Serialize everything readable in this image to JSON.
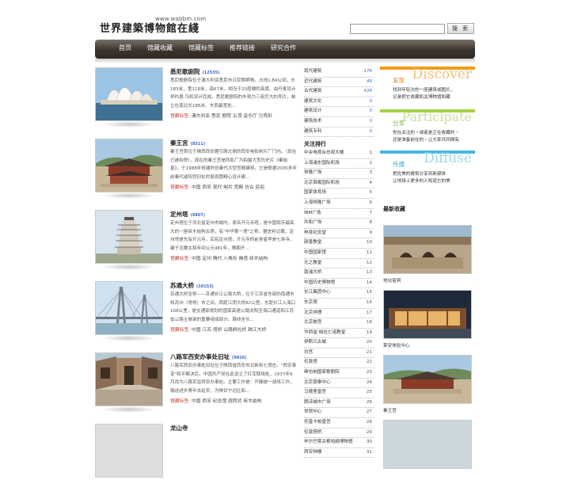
{
  "header": {
    "logo_url": "www.wabbm.com",
    "logo_text": "世界建築博物館在綫",
    "search_placeholder": "",
    "search_button": "搜 索"
  },
  "nav": [
    "首页",
    "馆藏收藏",
    "馆藏标签",
    "推荐链接",
    "研究合作"
  ],
  "entries": [
    {
      "title": "悉尼歌剧院",
      "count": "(12535)",
      "desc": "悉尼歌剧院位于澳大利亚悉尼市贝尼朗岬角。占地1.84公顷，长183米，宽118米，高67米，相当于20层楼的高度。由丹麦设计师约恩·乌松设计完成。悉尼歌剧院的外观为三组巨大的壳片，耸立在南北长186米、东西最宽处...",
      "tags_label": "馆藏标签:",
      "tags": "澳大利亚 悉尼 剧院 尖顶 音乐厅 贝壳形"
    },
    {
      "title": "秦王宫",
      "count": "(8511)",
      "desc": "秦王宫首位于陕西西安雁引路北侧的西安电影制片厂门内。（现在已被拆除），现在的秦王宫是西影厂为拍摄大型历史片《秦始皇》，于1988年修建的仿秦代大型宫殿建筑。它是根据2000多年前秦代咸阳宫旧址的复原图精心设计建...",
      "tags_label": "馆藏标签:",
      "tags": "中国 西安 现代 制片 宫殿 仿古 民俗"
    },
    {
      "title": "定州塔",
      "count": "(9807)",
      "desc": "定州塔位于河北省定州市城内，原名开元寺塔，是中国现存最高大的一座砖木结构古塔，有\"中华第一塔\"之称。据史料记载，定州塔是先有开元寺，后有定州塔。开元寺的前身星早是七帝寺，建于北魏太和年间公元481年，隋朝开...",
      "tags_label": "馆藏标签:",
      "tags": "中国 定州 隋代 八角形 佛塔 砖木结构"
    },
    {
      "title": "苏通大桥",
      "count": "(10153)",
      "desc": "苏通大桥全称——苏通长江公路大桥，位于江苏省东部的南通市和苏州（常熟）市之间，西距江阴大桥82公里，东距长江入海口108公里，是交通部规划的国家高速公路沈阳至海口通道和江苏省公路主骨架的重要组成部分。路线全长...",
      "tags_label": "馆藏标签:",
      "tags": "中国 江苏 塔桥 公路斜拉桥 跨江大桥"
    },
    {
      "title": "八路军西安办事处旧址",
      "count": "(9826)",
      "desc": "八路军西安办事处旧址位于陕西省西安市北新街七贤庄。\"西安事变\"和平解决后，中国共产党在此设立了红军联络处，1937年9月改为八路军驻西安办事处。主要工作是：开展统一战线工作，输送进步青年去延安，为陕甘宁边区和...",
      "tags_label": "馆藏标签:",
      "tags": "中国 西安 纪念馆 庭院式 砖木结构"
    },
    {
      "title": "龙山寺",
      "count": "",
      "desc": "",
      "tags_label": "",
      "tags": ""
    }
  ],
  "categories": [
    {
      "label": "现代建筑",
      "count": "176"
    },
    {
      "label": "近代建筑",
      "count": "49"
    },
    {
      "label": "古代建筑",
      "count": "439"
    },
    {
      "label": "建筑文化",
      "count": "0"
    },
    {
      "label": "建筑设计",
      "count": "0"
    },
    {
      "label": "建筑技术",
      "count": "0"
    },
    {
      "label": "建筑专利",
      "count": "0"
    }
  ],
  "hot": {
    "title": "关注排行",
    "items": [
      {
        "label": "中央电视台总部大楼",
        "rank": "1"
      },
      {
        "label": "上海浦东国际机场",
        "rank": "2"
      },
      {
        "label": "恒隆广场",
        "rank": "3"
      },
      {
        "label": "北京首都国际机场",
        "rank": "4"
      },
      {
        "label": "国家体育场",
        "rank": "5"
      },
      {
        "label": "上海恒隆广场",
        "rank": "6"
      },
      {
        "label": "IBM广场",
        "rank": "7"
      },
      {
        "label": "共和广场",
        "rank": "8"
      },
      {
        "label": "林肯纪念堂",
        "rank": "9"
      },
      {
        "label": "颜香教堂",
        "rank": "10"
      },
      {
        "label": "中国国家馆",
        "rank": "11"
      },
      {
        "label": "光之教堂",
        "rank": "12"
      },
      {
        "label": "南浦大桥",
        "rank": "13"
      },
      {
        "label": "中国历史博物馆",
        "rank": "14"
      },
      {
        "label": "长江集团中心",
        "rank": "15"
      },
      {
        "label": "东京塔",
        "rank": "16"
      },
      {
        "label": "北京祥理",
        "rank": "17"
      },
      {
        "label": "北京故宫",
        "rank": "18"
      },
      {
        "label": "华西堂-柏拉仁诺教堂",
        "rank": "19"
      },
      {
        "label": "伊斯兰古城",
        "rank": "20"
      },
      {
        "label": "白宫",
        "rank": "21"
      },
      {
        "label": "伦敦塔",
        "rank": "22"
      },
      {
        "label": "维也纳国家歌剧院",
        "rank": "23"
      },
      {
        "label": "北京银泰中心",
        "rank": "24"
      },
      {
        "label": "马德里皇宫",
        "rank": "25"
      },
      {
        "label": "朗诗城市广场",
        "rank": "26"
      },
      {
        "label": "世贸中心",
        "rank": "27"
      },
      {
        "label": "托普卡帕皇宫",
        "rank": "28"
      },
      {
        "label": "伦敦塔桥",
        "rank": "29"
      },
      {
        "label": "毕尔巴鄂古根哈姆博物馆",
        "rank": "30"
      },
      {
        "label": "西安钟楼",
        "rank": "31"
      }
    ]
  },
  "promos": [
    {
      "en": "Discover",
      "cn": "发现",
      "l1": "找到年轻次的一座建筑或图片，",
      "l2": "记录把它收藏机关博物馆和藏",
      "color": "#e67e22",
      "bar": "#f39c12"
    },
    {
      "en": "Participate",
      "cn": "分享",
      "l1": "你在关注的・或者是正在收藏的・",
      "l2": "还是准备前往的・让大家共同拥有",
      "color": "#8bc34a",
      "bar": "#a5d046"
    },
    {
      "en": "Diffuse",
      "cn": "传播",
      "l1": "把优美的建筑分享到新媒体",
      "l2": "让地球上更多的人知道它的美",
      "color": "#3aaed8",
      "bar": "#45b8e0"
    }
  ],
  "latest": {
    "title": "最新收藏",
    "items": [
      {
        "caption": "地坑窑洞"
      },
      {
        "caption": "莱安体验中心"
      },
      {
        "caption": "秦王宫"
      },
      {
        "caption": ""
      }
    ]
  }
}
